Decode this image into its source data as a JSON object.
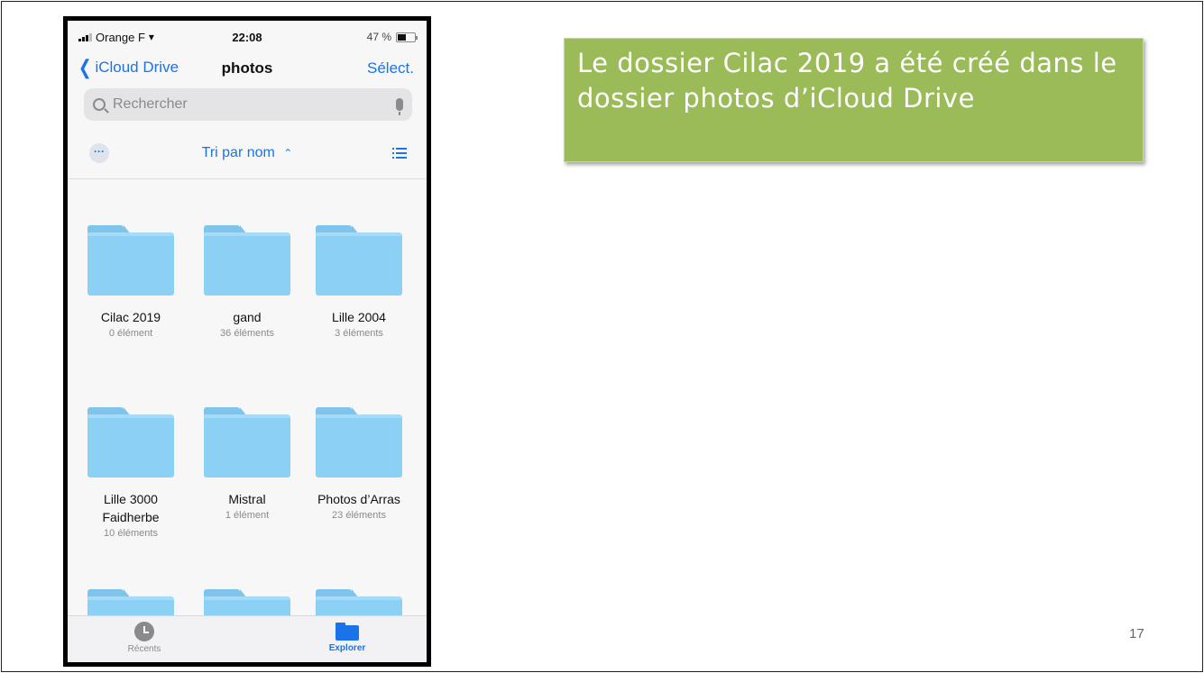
{
  "status_bar": {
    "carrier": "Orange F",
    "time": "22:08",
    "battery": "47 %"
  },
  "nav": {
    "back_label": "iCloud Drive",
    "title": "photos",
    "select_label": "Sélect."
  },
  "search": {
    "placeholder": "Rechercher"
  },
  "toolbar": {
    "more_label": "···",
    "sort_label": "Tri par nom"
  },
  "folders": [
    {
      "name": "Cilac 2019",
      "name2": "",
      "count": "0 élément"
    },
    {
      "name": "gand",
      "name2": "",
      "count": "36 éléments"
    },
    {
      "name": "Lille 2004",
      "name2": "",
      "count": "3 éléments"
    },
    {
      "name": "Lille 3000",
      "name2": "Faidherbe",
      "count": "10 éléments"
    },
    {
      "name": "Mistral",
      "name2": "",
      "count": "1 élément"
    },
    {
      "name": "Photos d’Arras",
      "name2": "",
      "count": "23 éléments"
    }
  ],
  "tab_bar": {
    "recents_label": "Récents",
    "explorer_label": "Explorer"
  },
  "caption": {
    "text": "Le dossier Cilac 2019 a été créé dans le dossier photos d’iCloud Drive"
  },
  "slide_number": "17",
  "colors": {
    "ios_blue": "#1a73e8",
    "folder_blue": "#8dd0f5",
    "caption_green": "#9bbb59"
  }
}
